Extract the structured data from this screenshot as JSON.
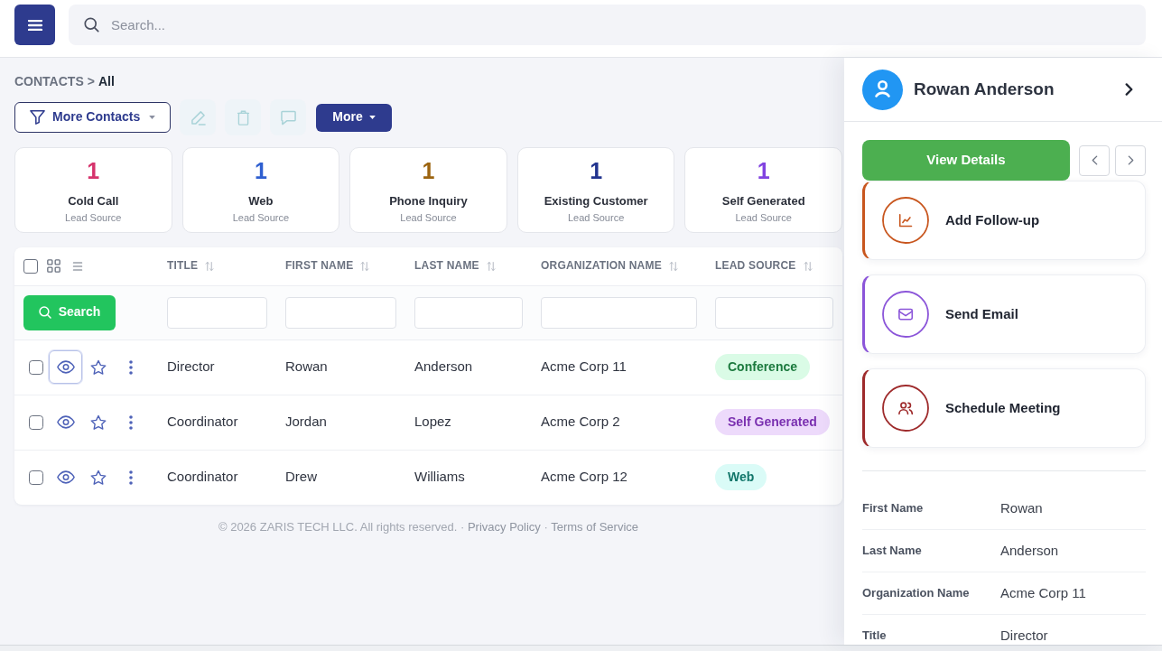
{
  "topbar": {
    "search": {
      "placeholder": "Search..."
    }
  },
  "breadcrumb": {
    "section": "CONTACTS",
    "separator": ">",
    "current": "All"
  },
  "toolbar": {
    "filter_button": {
      "label": "More Contacts"
    },
    "actions": [
      {
        "kind": "edit",
        "disabled": true
      },
      {
        "kind": "delete",
        "disabled": true
      },
      {
        "kind": "comment",
        "disabled": true
      }
    ],
    "more_button": {
      "label": "More"
    }
  },
  "stats": [
    {
      "count": "1",
      "label": "Cold Call",
      "sublabel": "Lead Source",
      "color": "#d6336c"
    },
    {
      "count": "1",
      "label": "Web",
      "sublabel": "Lead Source",
      "color": "#2f5fd0"
    },
    {
      "count": "1",
      "label": "Phone Inquiry",
      "sublabel": "Lead Source",
      "color": "#9c6410"
    },
    {
      "count": "1",
      "label": "Existing Customer",
      "sublabel": "Lead Source",
      "color": "#22348f"
    },
    {
      "count": "1",
      "label": "Self Generated",
      "sublabel": "Lead Source",
      "color": "#8143e0"
    }
  ],
  "table": {
    "select_all": {
      "checked": false
    },
    "columns": [
      "TITLE",
      "FIRST NAME",
      "LAST NAME",
      "ORGANIZATION NAME",
      "LEAD SOURCE"
    ],
    "search_button": {
      "label": "Search"
    },
    "rows": [
      {
        "checked": false,
        "focused": true,
        "starred": false,
        "cells": [
          "Director",
          "Rowan",
          "Anderson",
          "Acme Corp 11"
        ],
        "lead_source": {
          "label": "Conference",
          "color": "#1c7a3e"
        }
      },
      {
        "checked": false,
        "focused": false,
        "starred": false,
        "cells": [
          "Coordinator",
          "Jordan",
          "Lopez",
          "Acme Corp 2"
        ],
        "lead_source": {
          "label": "Self Generated",
          "color": "#7a30b0"
        }
      },
      {
        "checked": false,
        "focused": false,
        "starred": false,
        "cells": [
          "Coordinator",
          "Drew",
          "Williams",
          "Acme Corp 12"
        ],
        "lead_source": {
          "label": "Web",
          "color": "#11766a"
        }
      }
    ]
  },
  "footer": {
    "parts": [
      {
        "kind": "text",
        "text": "© 2026 ZARIS TECH LLC. All rights reserved. ·"
      },
      {
        "kind": "link",
        "text": "Privacy Policy"
      },
      {
        "kind": "text",
        "text": "·"
      },
      {
        "kind": "link",
        "text": "Terms of Service"
      }
    ]
  },
  "panel": {
    "name": "Rowan Anderson",
    "view_button": {
      "label": "View Details"
    },
    "actions": [
      {
        "kind": "follow_up",
        "label": "Add Follow-up",
        "color": "#c8561e"
      },
      {
        "kind": "email",
        "label": "Send Email",
        "color": "#8b55d9"
      },
      {
        "kind": "meeting",
        "label": "Schedule Meeting",
        "color": "#9e2a2b"
      }
    ],
    "details": [
      {
        "label": "First Name",
        "value": "Rowan"
      },
      {
        "label": "Last Name",
        "value": "Anderson"
      },
      {
        "label": "Organization Name",
        "value": "Acme Corp 11"
      },
      {
        "label": "Title",
        "value": "Director"
      }
    ]
  }
}
